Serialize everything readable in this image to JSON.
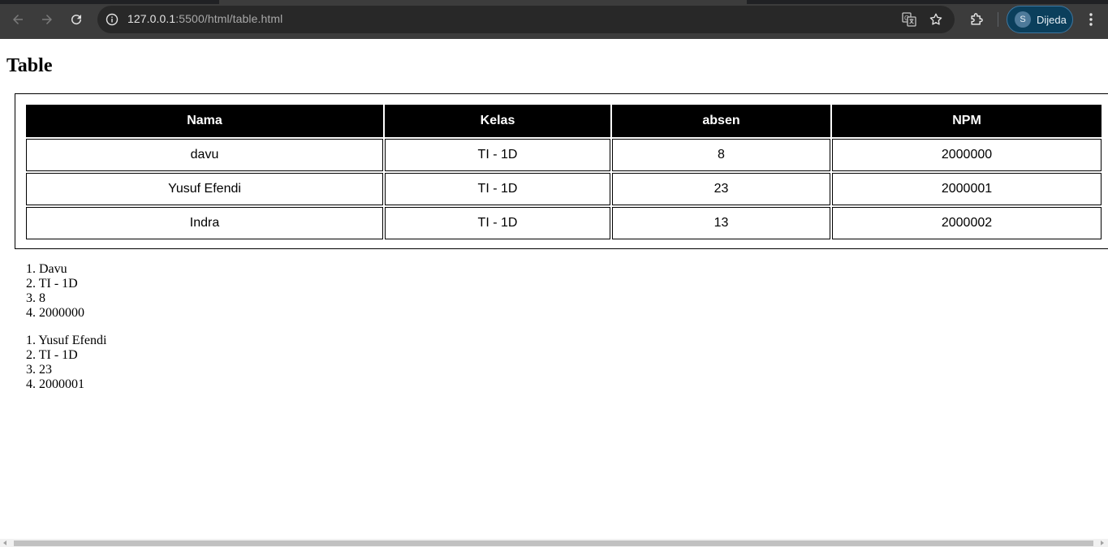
{
  "browser": {
    "url_host": "127.0.0.1",
    "url_rest": ":5500/html/table.html",
    "profile_initial": "S",
    "profile_name": "Dijeda",
    "icons": [
      "back-arrow-icon",
      "forward-arrow-icon",
      "reload-icon",
      "site-info-icon",
      "translate-icon",
      "bookmark-star-icon",
      "extensions-puzzle-icon",
      "kebab-menu-icon"
    ],
    "colors": {
      "toolbar": "#3c3c3c",
      "omnibox": "#282828",
      "profile_chip": "#0b3f5c"
    }
  },
  "page": {
    "heading": "Table",
    "table": {
      "headers": [
        "Nama",
        "Kelas",
        "absen",
        "NPM"
      ],
      "rows": [
        [
          "davu",
          "TI - 1D",
          "8",
          "2000000"
        ],
        [
          "Yusuf Efendi",
          "TI - 1D",
          "23",
          "2000001"
        ],
        [
          "Indra",
          "TI - 1D",
          "13",
          "2000002"
        ]
      ],
      "header_bg": "#000000",
      "header_color": "#ffffff"
    },
    "lists": [
      {
        "items": [
          "1. Davu",
          "2. TI - 1D",
          "3. 8",
          "4. 2000000"
        ]
      },
      {
        "items": [
          "1. Yusuf Efendi",
          "2. TI - 1D",
          "3. 23",
          "4. 2000001"
        ]
      }
    ]
  }
}
